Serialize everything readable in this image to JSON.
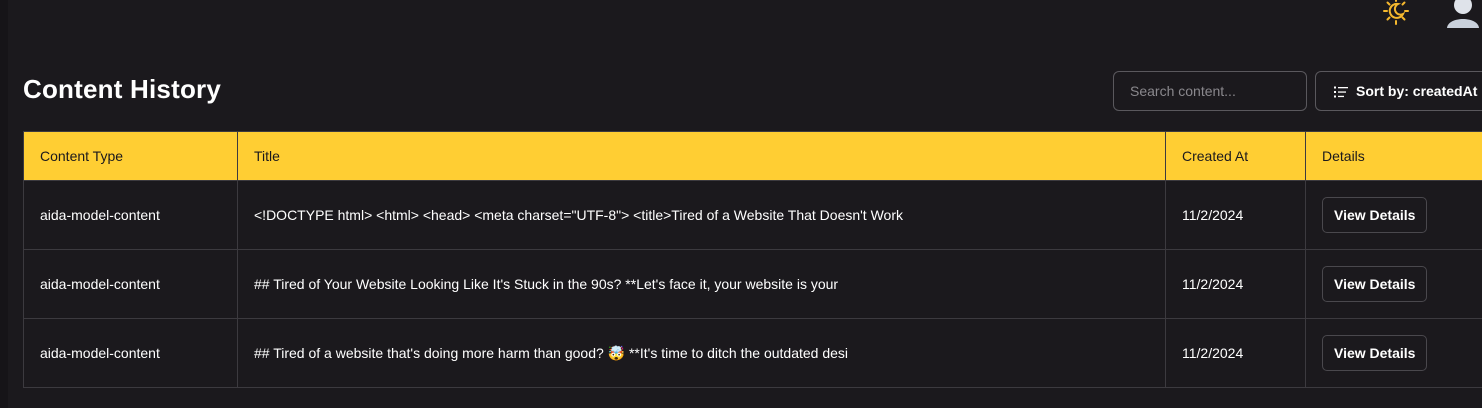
{
  "header": {
    "title": "Content History",
    "search": {
      "placeholder": "Search content...",
      "value": ""
    },
    "sort_label": "Sort by: createdAt"
  },
  "colors": {
    "background": "#1b191d",
    "header_accent": "#ffce33",
    "border": "#3c3a3f"
  },
  "icons": {
    "theme_toggle": "sun-moon-icon",
    "avatar": "user-avatar-icon",
    "sort": "sort-list-icon"
  },
  "table": {
    "columns": [
      "Content Type",
      "Title",
      "Created At",
      "Details"
    ],
    "rows": [
      {
        "content_type": "aida-model-content",
        "title": "<!DOCTYPE html> <html> <head> <meta charset=\"UTF-8\"> <title>Tired of a Website That Doesn't Work",
        "created_at": "11/2/2024",
        "action": "View Details"
      },
      {
        "content_type": "aida-model-content",
        "title": "## Tired of Your Website Looking Like It's Stuck in the 90s? **Let's face it, your website is your",
        "created_at": "11/2/2024",
        "action": "View Details"
      },
      {
        "content_type": "aida-model-content",
        "title": "## Tired of a website that's doing more harm than good? 🤯 **It's time to ditch the outdated desi",
        "created_at": "11/2/2024",
        "action": "View Details"
      }
    ]
  }
}
